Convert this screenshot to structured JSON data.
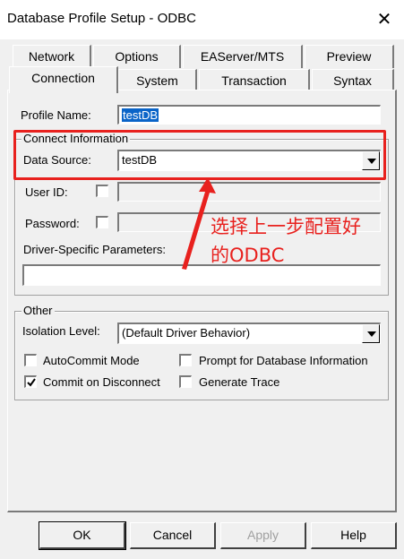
{
  "window": {
    "title": "Database Profile Setup - ODBC",
    "close_glyph": "✕"
  },
  "tabs_back": [
    {
      "label": "Network"
    },
    {
      "label": "Options"
    },
    {
      "label": "EAServer/MTS"
    },
    {
      "label": "Preview"
    }
  ],
  "tabs_front": [
    {
      "label": "Connection",
      "active": true
    },
    {
      "label": "System"
    },
    {
      "label": "Transaction"
    },
    {
      "label": "Syntax"
    }
  ],
  "profile": {
    "label": "Profile Name:",
    "value": "testDB"
  },
  "connect_info": {
    "legend": "Connect Information",
    "data_source_label": "Data Source:",
    "data_source_value": "testDB",
    "user_id_label": "User ID:",
    "password_label": "Password:",
    "driver_params_label": "Driver-Specific Parameters:"
  },
  "other": {
    "legend": "Other",
    "isolation_label": "Isolation Level:",
    "isolation_value": "(Default Driver Behavior)",
    "autocommit_label": "AutoCommit Mode",
    "autocommit_checked": false,
    "commit_disconnect_label": "Commit on Disconnect",
    "commit_disconnect_checked": true,
    "prompt_db_info_label": "Prompt for Database Information",
    "prompt_db_info_checked": false,
    "generate_trace_label": "Generate Trace",
    "generate_trace_checked": false
  },
  "buttons": {
    "ok": "OK",
    "cancel": "Cancel",
    "apply": "Apply",
    "help": "Help"
  },
  "annotation": {
    "line1": "选择上一步配置好",
    "line2": "的ODBC",
    "color": "#e8211e"
  }
}
